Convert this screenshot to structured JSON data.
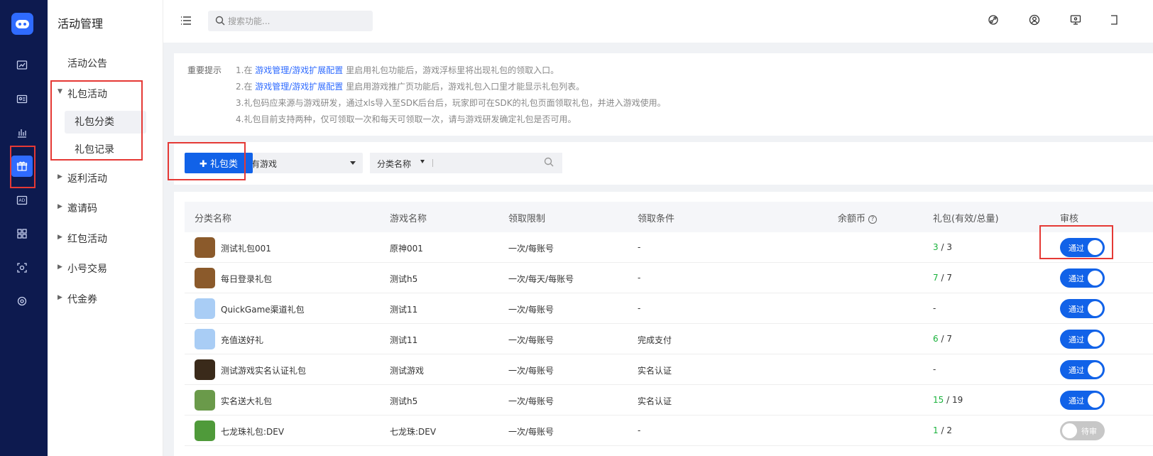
{
  "sidebar": {
    "title": "活动管理",
    "items": {
      "announcement": "活动公告",
      "gift": "礼包活动",
      "gift_category": "礼包分类",
      "gift_record": "礼包记录",
      "rebate": "返利活动",
      "invite": "邀请码",
      "redpack": "红包活动",
      "alt_trade": "小号交易",
      "voucher": "代金券"
    }
  },
  "topbar": {
    "search_placeholder": "搜索功能..."
  },
  "tips": {
    "label": "重要提示",
    "l1_a": "1.在 ",
    "l1_link": "游戏管理/游戏扩展配置",
    "l1_b": " 里启用礼包功能后，游戏浮标里将出现礼包的领取入口。",
    "l2_a": "2.在 ",
    "l2_link": "游戏管理/游戏扩展配置",
    "l2_b": " 里启用游戏推广页功能后，游戏礼包入口里才能显示礼包列表。",
    "l3": "3.礼包码应来源与游戏研发，通过xls导入至SDK后台后，玩家即可在SDK的礼包页面领取礼包，并进入游戏使用。",
    "l4": "4.礼包目前支持两种，仅可领取一次和每天可领取一次，请与游戏研发确定礼包是否可用。"
  },
  "toolbar": {
    "add_label": "✚ 礼包类",
    "game_select": "所有游戏",
    "category_select": "分类名称"
  },
  "table": {
    "headers": [
      "分类名称",
      "游戏名称",
      "领取限制",
      "领取条件",
      "余额币",
      "礼包(有效/总量)",
      "审核"
    ],
    "rows": [
      {
        "name": "测试礼包001",
        "game": "原神001",
        "limit": "一次/每账号",
        "cond": "-",
        "valid": "3",
        "total": " / 3",
        "review": "通过",
        "thumb": "#8b5a2b"
      },
      {
        "name": "每日登录礼包",
        "game": "测试h5",
        "limit": "一次/每天/每账号",
        "cond": "-",
        "valid": "7",
        "total": " / 7",
        "review": "通过",
        "thumb": "#8b5a2b"
      },
      {
        "name": "QuickGame渠道礼包",
        "game": "测试11",
        "limit": "一次/每账号",
        "cond": "-",
        "valid": "-",
        "total": "",
        "review": "通过",
        "thumb": "#a9cdf5"
      },
      {
        "name": "充值送好礼",
        "game": "测试11",
        "limit": "一次/每账号",
        "cond": "完成支付",
        "valid": "6",
        "total": " / 7",
        "review": "通过",
        "thumb": "#a9cdf5"
      },
      {
        "name": "测试游戏实名认证礼包",
        "game": "测试游戏",
        "limit": "一次/每账号",
        "cond": "实名认证",
        "valid": "-",
        "total": "",
        "review": "通过",
        "thumb": "#3a2a1a"
      },
      {
        "name": "实名送大礼包",
        "game": "测试h5",
        "limit": "一次/每账号",
        "cond": "实名认证",
        "valid": "15",
        "total": " / 19",
        "review": "通过",
        "thumb": "#6a9a4a"
      },
      {
        "name": "七龙珠礼包:DEV",
        "game": "七龙珠:DEV",
        "limit": "一次/每账号",
        "cond": "-",
        "valid": "1",
        "total": " / 2",
        "review": "待审",
        "thumb": "#4f9a3a"
      }
    ]
  }
}
